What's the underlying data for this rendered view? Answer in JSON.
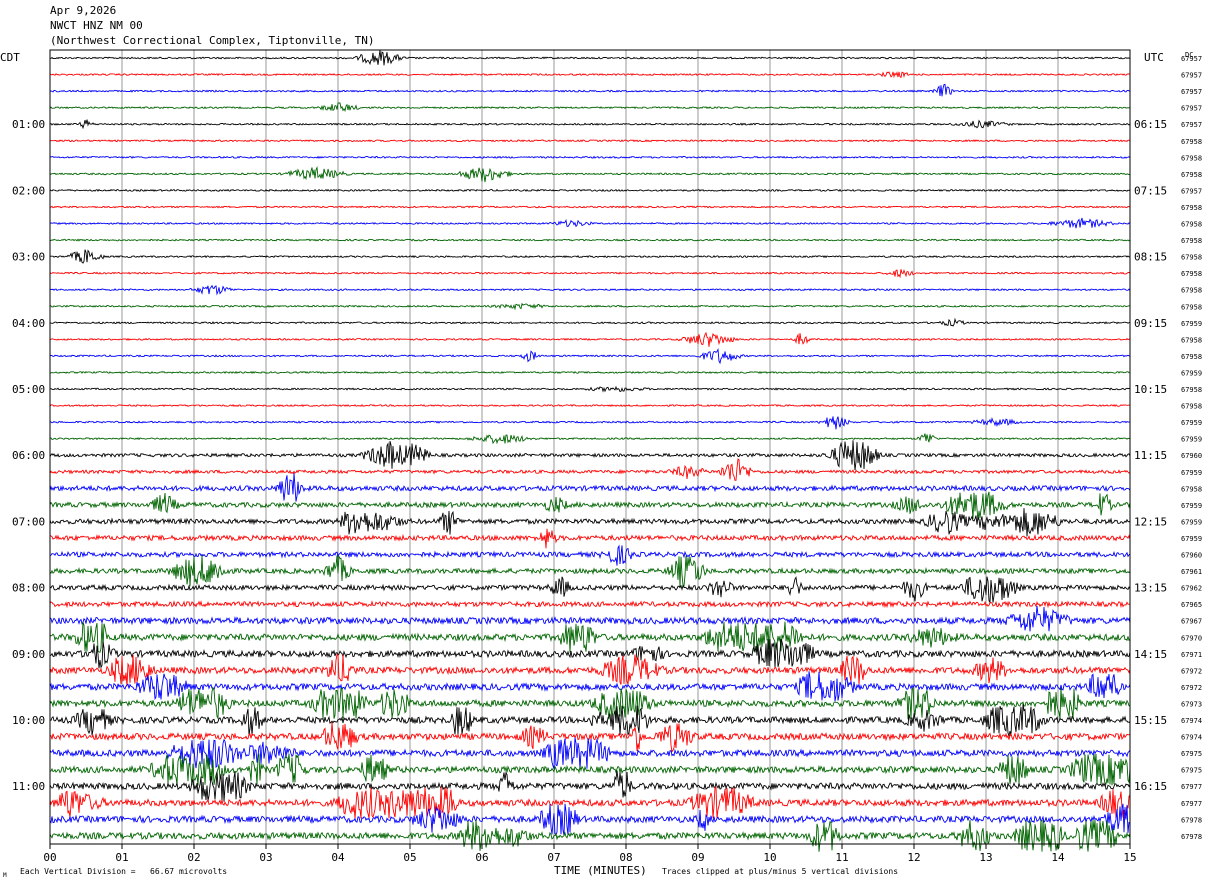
{
  "header": {
    "date": "Apr 9,2026",
    "station": "NWCT HNZ NM 00",
    "location": "(Northwest Correctional Complex, Tiptonville, TN)"
  },
  "left_label": "CDT",
  "right_label": "UTC",
  "dc_label": "DC",
  "footer": {
    "scale_note": "Each Vertical Division =   66.67 microvolts",
    "clip_note": "Traces clipped at plus/minus 5 vertical divisions",
    "corner_mark": "M"
  },
  "colors": {
    "cycle": [
      "#000000",
      "#ff0000",
      "#0000ff",
      "#006400"
    ],
    "grid": "#808080"
  },
  "chart_data": {
    "type": "line",
    "title": "",
    "xlabel": "TIME (MINUTES)",
    "ylabel": "",
    "xlim": [
      0,
      15
    ],
    "x_ticks": [
      "00",
      "01",
      "02",
      "03",
      "04",
      "05",
      "06",
      "07",
      "08",
      "09",
      "10",
      "11",
      "12",
      "13",
      "14",
      "15"
    ],
    "grid": true,
    "traces_per_hour": 4,
    "left_hour_labels": [
      "01:00",
      "02:00",
      "03:00",
      "04:00",
      "05:00",
      "06:00",
      "07:00",
      "08:00",
      "09:00",
      "10:00",
      "11:00"
    ],
    "right_hour_labels": [
      "06:15",
      "07:15",
      "08:15",
      "09:15",
      "10:15",
      "11:15",
      "12:15",
      "13:15",
      "14:15",
      "15:15",
      "16:15"
    ],
    "dc_offsets": [
      67957,
      67957,
      67957,
      67957,
      67957,
      67958,
      67958,
      67958,
      67957,
      67958,
      67958,
      67958,
      67958,
      67958,
      67958,
      67958,
      67959,
      67958,
      67958,
      67959,
      67958,
      67958,
      67959,
      67959,
      67960,
      67959,
      67958,
      67959,
      67959,
      67959,
      67960,
      67961,
      67962,
      67965,
      67967,
      67970,
      67971,
      67972,
      67972,
      67973,
      67974,
      67974,
      67975,
      67975,
      67977,
      67977,
      67978,
      67978
    ],
    "trace_activity": [
      1,
      1,
      1,
      1,
      1,
      1,
      1,
      1,
      1,
      1,
      1,
      1,
      1,
      1,
      1,
      1,
      1,
      1,
      1,
      1,
      1,
      1,
      1,
      1,
      2,
      2,
      3,
      3,
      3,
      3,
      3,
      3,
      3,
      3,
      4,
      4,
      4,
      4,
      4,
      4,
      4,
      4,
      4,
      4,
      4,
      4,
      4,
      4
    ],
    "note": "Helicorder record; waveform amplitudes are visual noise, DC offsets per trace listed above"
  }
}
